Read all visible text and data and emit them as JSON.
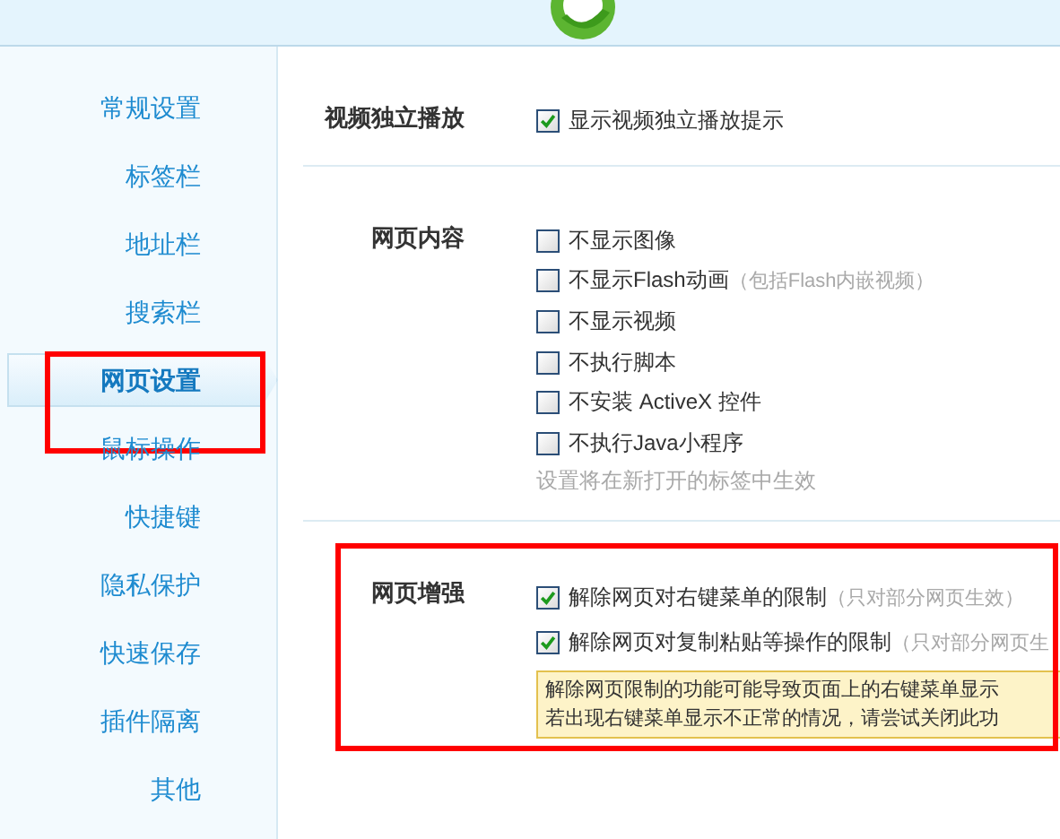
{
  "sidebar": {
    "items": [
      {
        "label": "常规设置",
        "selected": false,
        "highlighted": false
      },
      {
        "label": "标签栏",
        "selected": false,
        "highlighted": false
      },
      {
        "label": "地址栏",
        "selected": false,
        "highlighted": false
      },
      {
        "label": "搜索栏",
        "selected": false,
        "highlighted": false
      },
      {
        "label": "网页设置",
        "selected": true,
        "highlighted": true
      },
      {
        "label": "鼠标操作",
        "selected": false,
        "highlighted": false
      },
      {
        "label": "快捷键",
        "selected": false,
        "highlighted": false
      },
      {
        "label": "隐私保护",
        "selected": false,
        "highlighted": false
      },
      {
        "label": "快速保存",
        "selected": false,
        "highlighted": false
      },
      {
        "label": "插件隔离",
        "selected": false,
        "highlighted": false
      },
      {
        "label": "其他",
        "selected": false,
        "highlighted": false
      }
    ]
  },
  "sections": [
    {
      "label": "视频独立播放",
      "highlighted": false,
      "options": [
        {
          "label": "显示视频独立播放提示",
          "checked": true
        }
      ]
    },
    {
      "label": "网页内容",
      "highlighted": false,
      "options": [
        {
          "label": "不显示图像",
          "checked": false
        },
        {
          "label": "不显示Flash动画",
          "hint": "（包括Flash内嵌视频）",
          "checked": false
        },
        {
          "label": "不显示视频",
          "checked": false
        },
        {
          "label": "不执行脚本",
          "checked": false
        },
        {
          "label": "不安装 ActiveX 控件",
          "checked": false
        },
        {
          "label": "不执行Java小程序",
          "checked": false
        }
      ],
      "note": "设置将在新打开的标签中生效"
    },
    {
      "label": "网页增强",
      "highlighted": true,
      "options": [
        {
          "label": "解除网页对右键菜单的限制",
          "hint": "（只对部分网页生效）",
          "checked": true
        },
        {
          "label": "解除网页对复制粘贴等操作的限制",
          "hint": "（只对部分网页生",
          "checked": true
        }
      ],
      "warning": [
        "解除网页限制的功能可能导致页面上的右键菜单显示",
        "若出现右键菜单显示不正常的情况，请尝试关闭此功"
      ]
    }
  ]
}
